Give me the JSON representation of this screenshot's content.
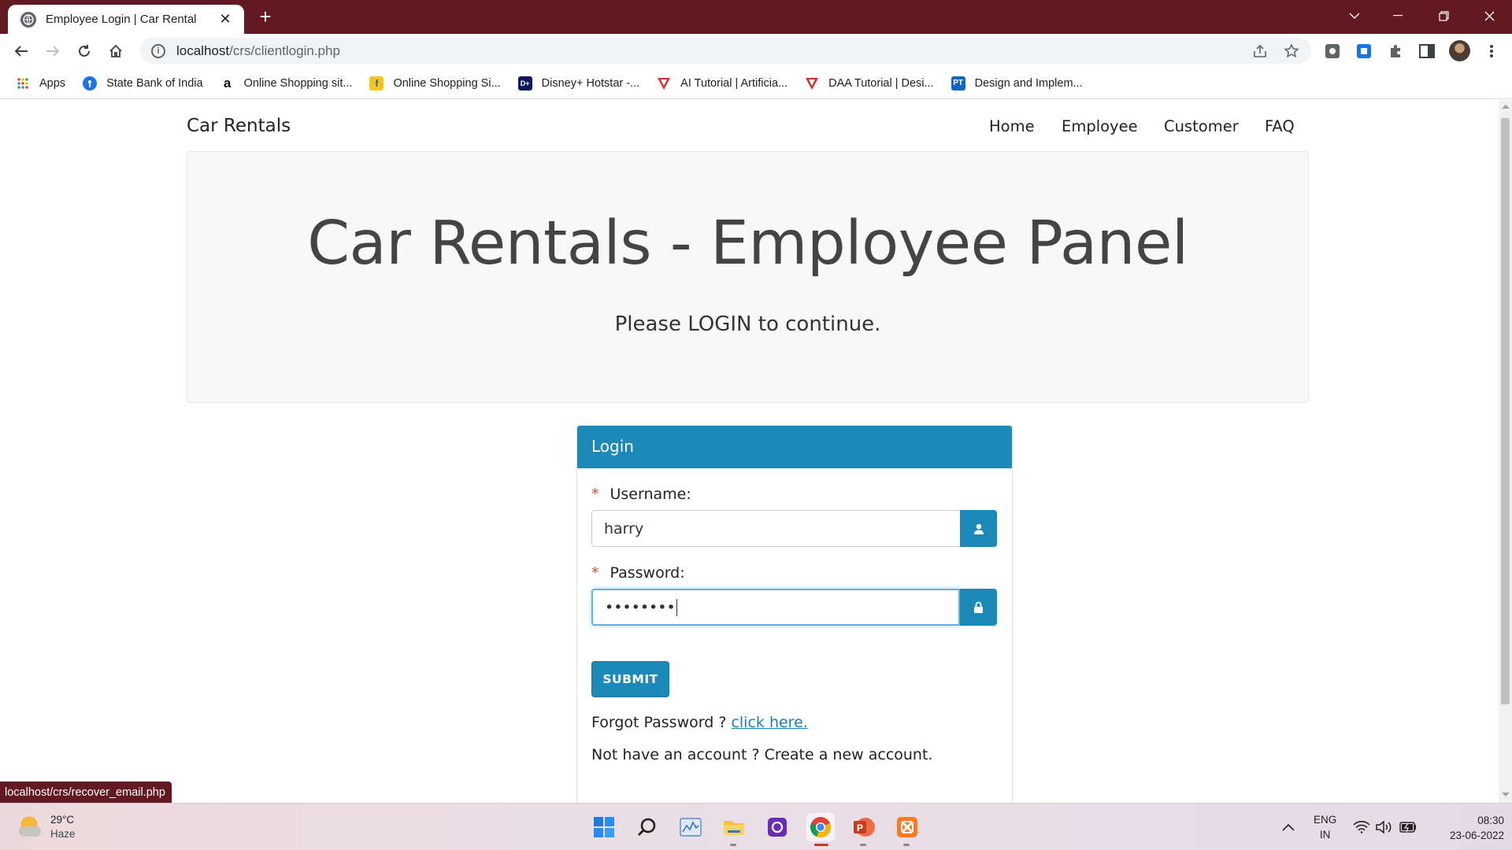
{
  "browser": {
    "tab_title": "Employee Login | Car Rental",
    "url_host": "localhost",
    "url_path": "/crs/clientlogin.php",
    "bookmarks": [
      {
        "label": "Apps",
        "icon": "apps-grid-icon",
        "color": "#ea4335"
      },
      {
        "label": "State Bank of India",
        "icon": "sbi-icon",
        "color": "#1a73e8"
      },
      {
        "label": "Online Shopping sit...",
        "icon": "amazon-icon",
        "color": "#111111"
      },
      {
        "label": "Online Shopping Si...",
        "icon": "flipkart-icon",
        "color": "#f5c518"
      },
      {
        "label": "Disney+ Hotstar -...",
        "icon": "hotstar-icon",
        "color": "#0c1a5b"
      },
      {
        "label": "AI Tutorial | Artificia...",
        "icon": "javatpoint-icon",
        "color": "#d32f2f"
      },
      {
        "label": "DAA Tutorial | Desi...",
        "icon": "javatpoint-icon",
        "color": "#d32f2f"
      },
      {
        "label": "Design and Implem...",
        "icon": "pt-icon",
        "color": "#1565c0"
      }
    ],
    "status_url": "localhost/crs/recover_email.php"
  },
  "site": {
    "brand": "Car Rentals",
    "nav": [
      "Home",
      "Employee",
      "Customer",
      "FAQ"
    ],
    "jumbotron_title": "Car Rentals - Employee Panel",
    "jumbotron_subtitle": "Please LOGIN to continue."
  },
  "login": {
    "panel_title": "Login",
    "required_mark": "*",
    "username_label": "Username:",
    "username_value": "harry",
    "password_label": "Password:",
    "password_value": "••••••••",
    "submit_label": "SUBMIT",
    "forgot_prefix": "Forgot Password ? ",
    "forgot_link": "click here.",
    "signup_text": "Not have an account ? Create a new account."
  },
  "taskbar": {
    "weather_temp": "29°C",
    "weather_desc": "Haze",
    "lang_top": "ENG",
    "lang_bottom": "IN",
    "time": "08:30",
    "date": "23-06-2022"
  },
  "colors": {
    "titlebar": "#631922",
    "panel_primary": "#1b8ab9",
    "link": "#1b7fb9",
    "required": "#e0463a"
  }
}
